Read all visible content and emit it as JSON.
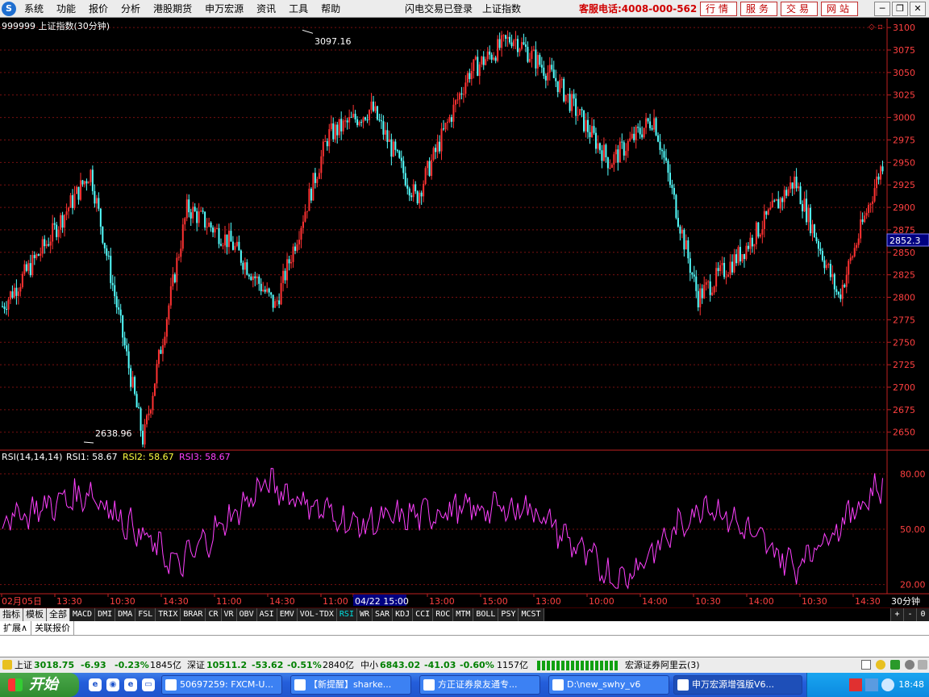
{
  "menubar": {
    "logo": "S",
    "items": [
      "系统",
      "功能",
      "报价",
      "分析",
      "港股期货",
      "申万宏源",
      "资讯",
      "工具",
      "帮助"
    ],
    "login_status": "闪电交易已登录",
    "current_index": "上证指数",
    "hotline": "客服电话:4008-000-562",
    "buttons": [
      "行情",
      "服务",
      "交易",
      "网站"
    ]
  },
  "chart_header": {
    "title": "999999 上证指数(30分钟)"
  },
  "price_chart": {
    "ylim": [
      2630,
      3110
    ],
    "yticks": [
      2650,
      2675,
      2700,
      2725,
      2750,
      2775,
      2800,
      2825,
      2850,
      2875,
      2900,
      2925,
      2950,
      2975,
      3000,
      3025,
      3050,
      3075,
      3100
    ],
    "ytick_labels": [
      "2650",
      "2675",
      "2700",
      "2725",
      "2750",
      "2775",
      "2800",
      "2825",
      "2850",
      "2875",
      "2900",
      "2925",
      "2950",
      "2975",
      "3000",
      "3025",
      "3050",
      "3075",
      "3100"
    ],
    "current_price_label": "2852.3",
    "high_label": "3097.16",
    "low_label": "2638.96",
    "up_color": "#ff3232",
    "down_color": "#54ffff"
  },
  "rsi_panel": {
    "label": "RSI(14,14,14)",
    "rsi1": "RSI1: 58.67",
    "rsi2": "RSI2: 58.67",
    "rsi3": "RSI3: 58.67",
    "ylim": [
      15,
      85
    ],
    "ytick_labels": [
      "80.00",
      "50.00",
      "20.00"
    ],
    "line_color": "#ff40ff"
  },
  "chart_data": [
    {
      "type": "line",
      "x": [
        0,
        5,
        10,
        16,
        21,
        26,
        31,
        37,
        42,
        47,
        53,
        58,
        63,
        69,
        74,
        79,
        84,
        90,
        95,
        100
      ],
      "series": [
        {
          "values": [
            2790,
            2860,
            2940,
            2640,
            2900,
            2860,
            2790,
            2980,
            3010,
            2910,
            3050,
            3090,
            3040,
            2950,
            3000,
            2800,
            2850,
            2930,
            2800,
            2950
          ]
        }
      ],
      "ylim": [
        2630,
        3110
      ]
    },
    {
      "type": "line",
      "x": [
        0,
        10,
        20,
        30,
        40,
        50,
        60,
        70,
        80,
        90,
        100
      ],
      "series": [
        {
          "values": [
            55,
            70,
            30,
            75,
            52,
            60,
            62,
            21,
            65,
            30,
            75
          ]
        }
      ],
      "ylim": [
        15,
        85
      ]
    }
  ],
  "time_axis": {
    "labels": [
      "02月05日",
      "13:30",
      "10:30",
      "14:30",
      "11:00",
      "14:30",
      "11:00",
      "04/22 15:00",
      "13:00",
      "15:00",
      "13:00",
      "10:00",
      "14:00",
      "10:30",
      "14:00",
      "10:30",
      "14:30"
    ],
    "period_label": "30分钟"
  },
  "indicator_tabs": {
    "items": [
      "指标",
      "模板",
      "全部",
      "MACD",
      "DMI",
      "DMA",
      "FSL",
      "TRIX",
      "BRAR",
      "CR",
      "VR",
      "OBV",
      "ASI",
      "EMV",
      "VOL-TDX",
      "RSI",
      "WR",
      "SAR",
      "KDJ",
      "CCI",
      "ROC",
      "MTM",
      "BOLL",
      "PSY",
      "MCST"
    ],
    "active": "RSI",
    "right_controls": [
      "+",
      "-",
      "0"
    ]
  },
  "ext_tabs": [
    "扩展∧",
    "关联报价"
  ],
  "status_bar": {
    "sh_name": "上证",
    "sh_value": "3018.75",
    "sh_change": "-6.93",
    "sh_pct": "-0.23%",
    "sh_amount": "1845亿",
    "sz_name": "深证",
    "sz_value": "10511.2",
    "sz_change": "-53.62",
    "sz_pct": "-0.51%",
    "sz_amount": "2840亿",
    "zx_name": "中小",
    "zx_value": "6843.02",
    "zx_change": "-41.03",
    "zx_pct": "-0.60%",
    "zx_amount": "1157亿",
    "server": "宏源证券阿里云(3)"
  },
  "taskbar": {
    "start_label": "开始",
    "tasks": [
      "50697259: FXCM-U...",
      "【新提醒】sharke...",
      "方正证券泉友通专...",
      "D:\\new_swhy_v6",
      "申万宏源增强版V6..."
    ],
    "clock": "18:48"
  }
}
